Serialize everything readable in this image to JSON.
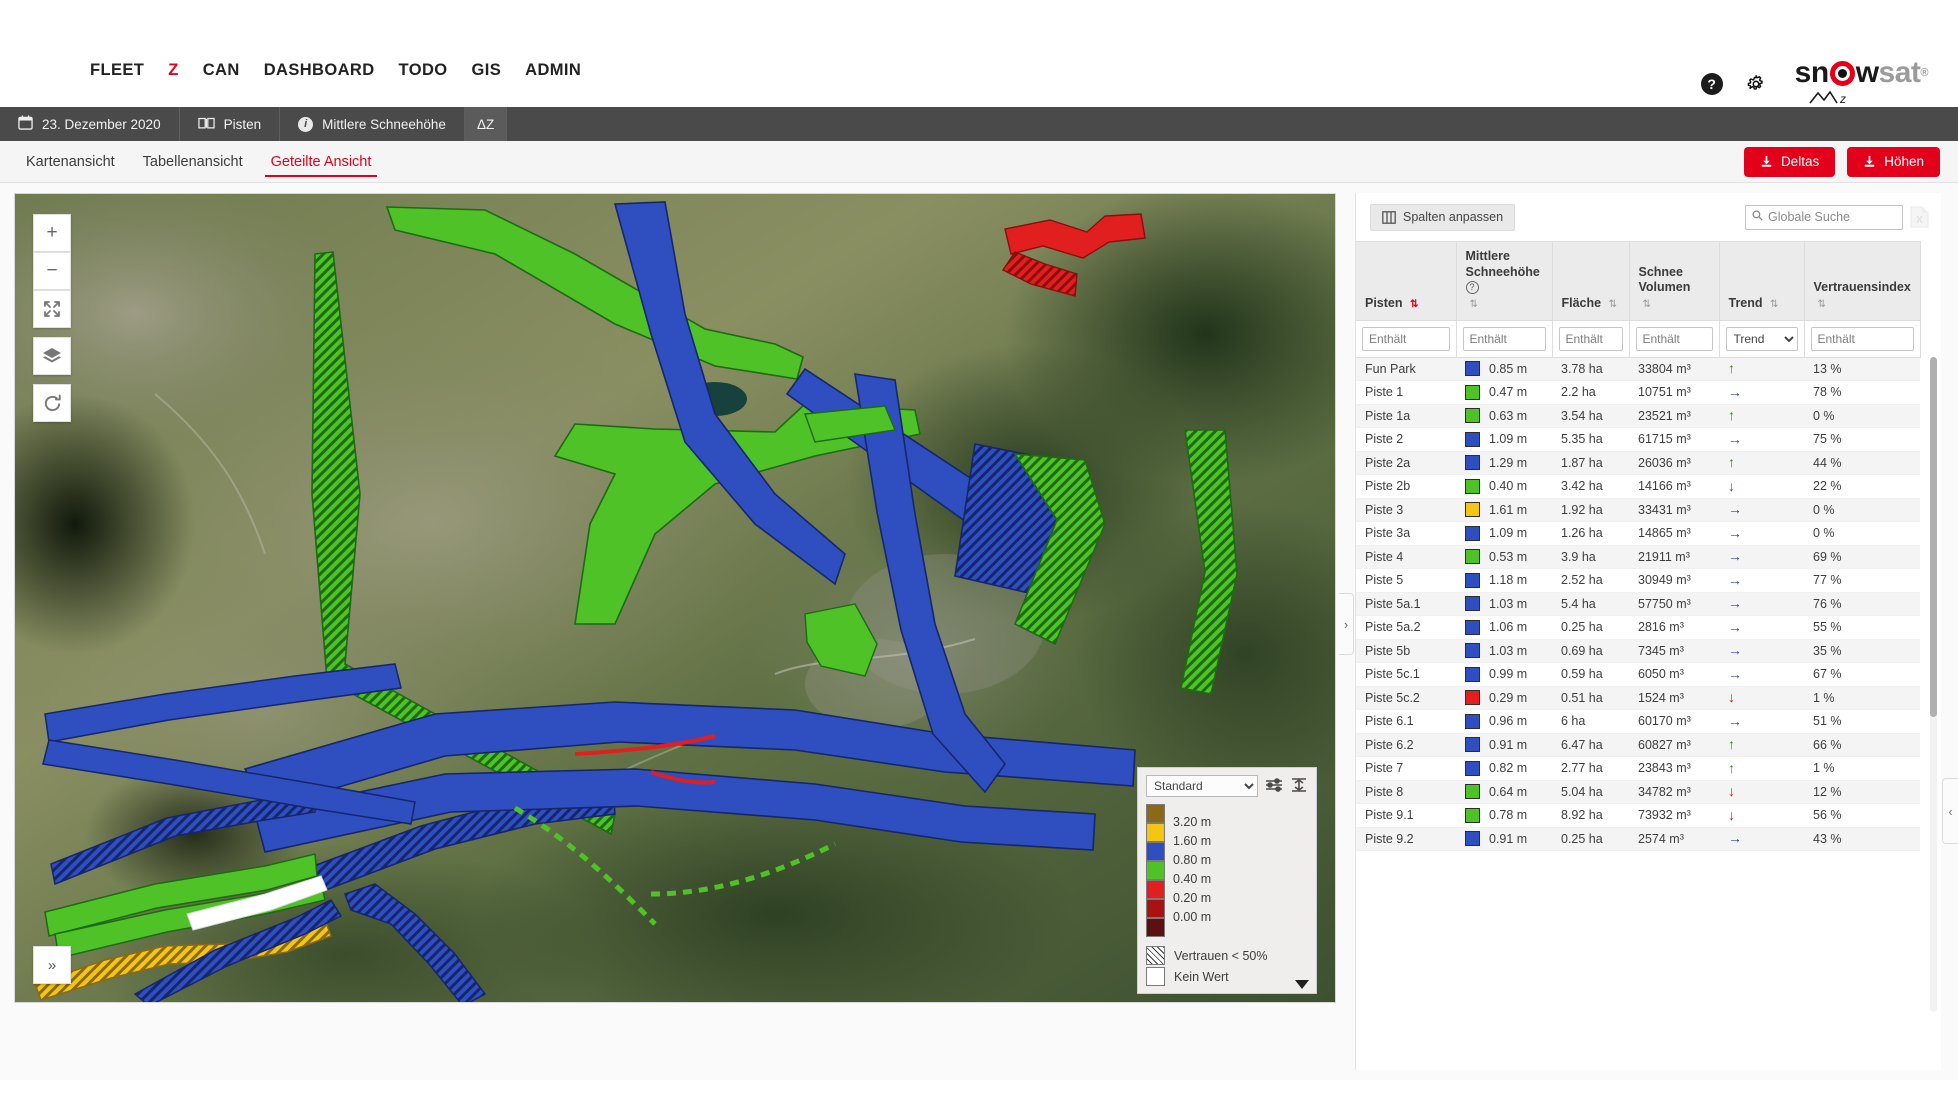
{
  "topnav": {
    "links": [
      {
        "label": "FLEET",
        "active": false
      },
      {
        "label": "Z",
        "active": true
      },
      {
        "label": "CAN",
        "active": false
      },
      {
        "label": "DASHBOARD",
        "active": false
      },
      {
        "label": "TODO",
        "active": false
      },
      {
        "label": "GIS",
        "active": false
      },
      {
        "label": "ADMIN",
        "active": false
      }
    ],
    "help_icon": "?",
    "settings_icon": "gear-icon",
    "logo": {
      "part1": "sn",
      "part2": "w",
      "part3": "sat",
      "tm": "®",
      "sub": "z"
    }
  },
  "contextbar": {
    "date": "23. Dezember 2020",
    "layer": "Pisten",
    "metric": "Mittlere Schneehöhe",
    "delta": "ΔZ"
  },
  "viewtabs": {
    "items": [
      {
        "label": "Kartenansicht",
        "active": false
      },
      {
        "label": "Tabellenansicht",
        "active": false
      },
      {
        "label": "Geteilte Ansicht",
        "active": true
      }
    ],
    "buttons": [
      {
        "label": "Deltas"
      },
      {
        "label": "Höhen"
      }
    ]
  },
  "map": {
    "controls": [
      {
        "name": "zoom-in",
        "glyph": "+"
      },
      {
        "name": "zoom-out",
        "glyph": "−"
      },
      {
        "name": "fit-extent",
        "glyph": "fit-icon"
      },
      {
        "name": "layers",
        "glyph": "layers-icon"
      },
      {
        "name": "refresh",
        "glyph": "refresh-icon"
      }
    ],
    "expand_glyph": "»",
    "legend": {
      "preset": "Standard",
      "preset_options": [
        "Standard"
      ],
      "tool1": "settings-sliders-icon",
      "tool2": "collapse-icon",
      "scale_labels": [
        "3.20 m",
        "1.60 m",
        "0.80 m",
        "0.40 m",
        "0.20 m",
        "0.00 m"
      ],
      "scale_colors": [
        "#8a6a18",
        "#f4c613",
        "#2f4fc0",
        "#4fc228",
        "#e21f1f",
        "#a91212",
        "#5c1010"
      ],
      "extra": [
        {
          "label": "Vertrauen < 50%",
          "style": "hatch"
        },
        {
          "label": "Kein Wert",
          "style": "empty"
        }
      ]
    }
  },
  "splitters": {
    "left_handle": "›",
    "right_handle": "‹"
  },
  "table": {
    "columns_button": "Spalten anpassen",
    "search_placeholder": "Globale Suche",
    "search_value": "",
    "export_icon": "excel-export-icon",
    "headers": [
      {
        "label": "Pisten",
        "sorted": true
      },
      {
        "label": "Mittlere Schneehöhe",
        "has_help": true,
        "sorted": false
      },
      {
        "label": "Fläche",
        "sorted": false
      },
      {
        "label": "Schnee Volumen",
        "sorted": false
      },
      {
        "label": "Trend",
        "sorted": false
      },
      {
        "label": "Vertrauensindex",
        "sorted": false
      }
    ],
    "filters": [
      {
        "type": "text",
        "placeholder": "Enthält"
      },
      {
        "type": "text",
        "placeholder": "Enthält"
      },
      {
        "type": "text",
        "placeholder": "Enthält"
      },
      {
        "type": "text",
        "placeholder": "Enthält"
      },
      {
        "type": "select",
        "value": "Trend"
      },
      {
        "type": "text",
        "placeholder": "Enthält"
      }
    ],
    "rows": [
      {
        "piste": "Fun Park",
        "color": "#2f4fc0",
        "height": "0.85 m",
        "area": "3.78 ha",
        "volume": "33804 m³",
        "trend": "up",
        "confidence": "13 %"
      },
      {
        "piste": "Piste 1",
        "color": "#4fc228",
        "height": "0.47 m",
        "area": "2.2 ha",
        "volume": "10751 m³",
        "trend": "right",
        "confidence": "78 %"
      },
      {
        "piste": "Piste 1a",
        "color": "#4fc228",
        "height": "0.63 m",
        "area": "3.54 ha",
        "volume": "23521 m³",
        "trend": "up",
        "confidence": "0 %"
      },
      {
        "piste": "Piste 2",
        "color": "#2f4fc0",
        "height": "1.09 m",
        "area": "5.35 ha",
        "volume": "61715 m³",
        "trend": "right",
        "confidence": "75 %"
      },
      {
        "piste": "Piste 2a",
        "color": "#2f4fc0",
        "height": "1.29 m",
        "area": "1.87 ha",
        "volume": "26036 m³",
        "trend": "up",
        "confidence": "44 %"
      },
      {
        "piste": "Piste 2b",
        "color": "#4fc228",
        "height": "0.40 m",
        "area": "3.42 ha",
        "volume": "14166 m³",
        "trend": "down",
        "confidence": "22 %"
      },
      {
        "piste": "Piste 3",
        "color": "#f4c613",
        "height": "1.61 m",
        "area": "1.92 ha",
        "volume": "33431 m³",
        "trend": "right",
        "confidence": "0 %"
      },
      {
        "piste": "Piste 3a",
        "color": "#2f4fc0",
        "height": "1.09 m",
        "area": "1.26 ha",
        "volume": "14865 m³",
        "trend": "right",
        "confidence": "0 %"
      },
      {
        "piste": "Piste 4",
        "color": "#4fc228",
        "height": "0.53 m",
        "area": "3.9 ha",
        "volume": "21911 m³",
        "trend": "right",
        "confidence": "69 %"
      },
      {
        "piste": "Piste 5",
        "color": "#2f4fc0",
        "height": "1.18 m",
        "area": "2.52 ha",
        "volume": "30949 m³",
        "trend": "right",
        "confidence": "77 %"
      },
      {
        "piste": "Piste 5a.1",
        "color": "#2f4fc0",
        "height": "1.03 m",
        "area": "5.4 ha",
        "volume": "57750 m³",
        "trend": "right",
        "confidence": "76 %"
      },
      {
        "piste": "Piste 5a.2",
        "color": "#2f4fc0",
        "height": "1.06 m",
        "area": "0.25 ha",
        "volume": "2816 m³",
        "trend": "right",
        "confidence": "55 %"
      },
      {
        "piste": "Piste 5b",
        "color": "#2f4fc0",
        "height": "1.03 m",
        "area": "0.69 ha",
        "volume": "7345 m³",
        "trend": "right",
        "confidence": "35 %"
      },
      {
        "piste": "Piste 5c.1",
        "color": "#2f4fc0",
        "height": "0.99 m",
        "area": "0.59 ha",
        "volume": "6050 m³",
        "trend": "right",
        "confidence": "67 %"
      },
      {
        "piste": "Piste 5c.2",
        "color": "#e21f1f",
        "height": "0.29 m",
        "area": "0.51 ha",
        "volume": "1524 m³",
        "trend": "down",
        "confidence": "1 %"
      },
      {
        "piste": "Piste 6.1",
        "color": "#2f4fc0",
        "height": "0.96 m",
        "area": "6 ha",
        "volume": "60170 m³",
        "trend": "right",
        "confidence": "51 %"
      },
      {
        "piste": "Piste 6.2",
        "color": "#2f4fc0",
        "height": "0.91 m",
        "area": "6.47 ha",
        "volume": "60827 m³",
        "trend": "up",
        "confidence": "66 %"
      },
      {
        "piste": "Piste 7",
        "color": "#2f4fc0",
        "height": "0.82 m",
        "area": "2.77 ha",
        "volume": "23843 m³",
        "trend": "up",
        "confidence": "1 %"
      },
      {
        "piste": "Piste 8",
        "color": "#4fc228",
        "height": "0.64 m",
        "area": "5.04 ha",
        "volume": "34782 m³",
        "trend": "down",
        "confidence": "12 %"
      },
      {
        "piste": "Piste 9.1",
        "color": "#4fc228",
        "height": "0.78 m",
        "area": "8.92 ha",
        "volume": "73932 m³",
        "trend": "down",
        "confidence": "56 %"
      },
      {
        "piste": "Piste 9.2",
        "color": "#2f4fc0",
        "height": "0.91 m",
        "area": "0.25 ha",
        "volume": "2574 m³",
        "trend": "right",
        "confidence": "43 %"
      }
    ]
  }
}
